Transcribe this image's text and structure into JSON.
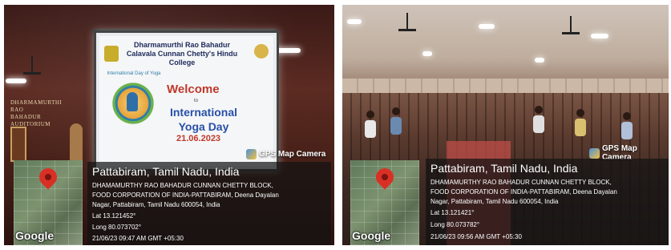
{
  "left_photo": {
    "slide": {
      "college_name": "Dharmamurthi Rao Bahadur Calavala Cunnan Chetty's Hindu College",
      "welcome": "Welcome",
      "to": "to",
      "event": "International Yoga Day",
      "date": "21.06.2023",
      "logo_text": "International Day of Yoga"
    },
    "wall_sign": "DHARMAMURTHI RAO BAHADUR AUDITORIUM",
    "gps_badge": "GPS Map Camera",
    "place": "Pattabiram, Tamil Nadu, India",
    "address_lines": [
      "DHAMAMURTHY RAO BAHADUR CUNNAN CHETTY BLOCK,",
      "FOOD CORPORATION OF INDIA-PATTABIRAM, Deena Dayalan",
      "Nagar, Pattabiram, Tamil Nadu 600054, India"
    ],
    "lat": "Lat 13.121452°",
    "long": "Long 80.073702°",
    "timestamp": "21/06/23 09:47 AM GMT +05:30",
    "map_brand": "Google"
  },
  "right_photo": {
    "gps_badge": "GPS Map Camera",
    "place": "Pattabiram, Tamil Nadu, India",
    "address_lines": [
      "DHAMAMURTHY RAO BAHADUR CUNNAN CHETTY BLOCK,",
      "FOOD CORPORATION OF INDIA-PATTABIRAM, Deena Dayalan",
      "Nagar, Pattabiram, Tamil Nadu 600054, India"
    ],
    "lat": "Lat 13.121421°",
    "long": "Long 80.073782°",
    "timestamp": "21/06/23 09:56 AM GMT +05:30",
    "map_brand": "Google"
  },
  "colors": {
    "pin": "#d93025",
    "panel": "rgba(20,20,20,0.72)",
    "welcome": "#c0392b",
    "event": "#2850a8"
  }
}
